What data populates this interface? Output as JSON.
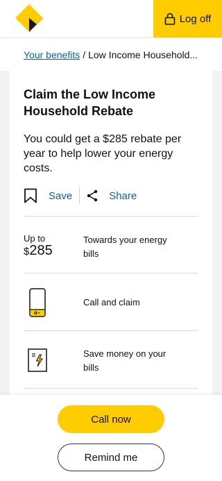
{
  "header": {
    "logo_icon": "commbank-diamond-logo",
    "brand_color": "#ffcc00",
    "logoff_icon": "padlock-icon",
    "logoff_label": "Log off"
  },
  "breadcrumb": {
    "link_label": "Your benefits",
    "separator": "/",
    "current": "Low Income Household..."
  },
  "card": {
    "title": "Claim the Low Income Household Rebate",
    "description": "You could get a $285 rebate per year to help lower your energy costs.",
    "save_label": "Save",
    "share_label": "Share",
    "link_color": "#0a64a4"
  },
  "features": {
    "amount_prefix": "Up to",
    "amount_currency": "$",
    "amount_value": "285",
    "amount_label": "Towards your energy bills",
    "call_label": "Call and claim",
    "call_icon": "phone-icon",
    "save_money_label": "Save money on your bills",
    "save_money_icon": "electricity-bill-icon"
  },
  "footer": {
    "call_now_label": "Call now",
    "remind_me_label": "Remind me"
  }
}
